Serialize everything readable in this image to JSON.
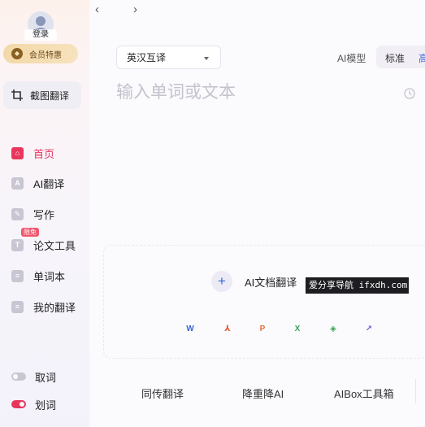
{
  "sidebar": {
    "login_label": "登录",
    "vip_label": "会员特惠",
    "screenshot_translate": "截图翻译",
    "nav": [
      {
        "label": "首页",
        "icon": "home-icon",
        "icon_text": "⌂"
      },
      {
        "label": "AI翻译",
        "icon": "ai-translate-icon",
        "icon_text": "A"
      },
      {
        "label": "写作",
        "icon": "pen-icon",
        "icon_text": "✎"
      },
      {
        "label": "论文工具",
        "icon": "paper-tool-icon",
        "icon_text": "T"
      },
      {
        "label": "单词本",
        "icon": "wordbook-icon",
        "icon_text": "≡"
      },
      {
        "label": "我的翻译",
        "icon": "my-translation-icon",
        "icon_text": "≡"
      }
    ],
    "new_badge": "限免",
    "toggles": [
      {
        "label": "取词",
        "state": "off"
      },
      {
        "label": "划词",
        "state": "on"
      }
    ]
  },
  "toolbar": {
    "back_glyph": "‹",
    "forward_glyph": "›",
    "language_pair": "英汉互译",
    "ai_model_label": "AI模型",
    "model_standard": "标准",
    "model_high": "高"
  },
  "input": {
    "placeholder": "输入单词或文本"
  },
  "doc_translate": {
    "label": "AI文档翻译",
    "plus_glyph": "+",
    "formats": [
      {
        "name": "word-icon",
        "glyph": "W",
        "color": "#3a66d6"
      },
      {
        "name": "pdf-icon",
        "glyph": "⅄",
        "color": "#e05a3a"
      },
      {
        "name": "ppt-icon",
        "glyph": "P",
        "color": "#e0703a"
      },
      {
        "name": "excel-icon",
        "glyph": "X",
        "color": "#3aa35a"
      },
      {
        "name": "image-icon",
        "glyph": "◈",
        "color": "#3aa35a"
      },
      {
        "name": "chart-icon",
        "glyph": "↗",
        "color": "#7a5ad6"
      }
    ]
  },
  "watermark": "爱分享导航 ifxdh.com",
  "bottom_tabs": [
    "同传翻译",
    "降重降AI",
    "AIBox工具箱"
  ],
  "colors": {
    "accent": "#e8365d",
    "blue": "#3a66d6",
    "vip_gold": "#f3d9a8"
  }
}
